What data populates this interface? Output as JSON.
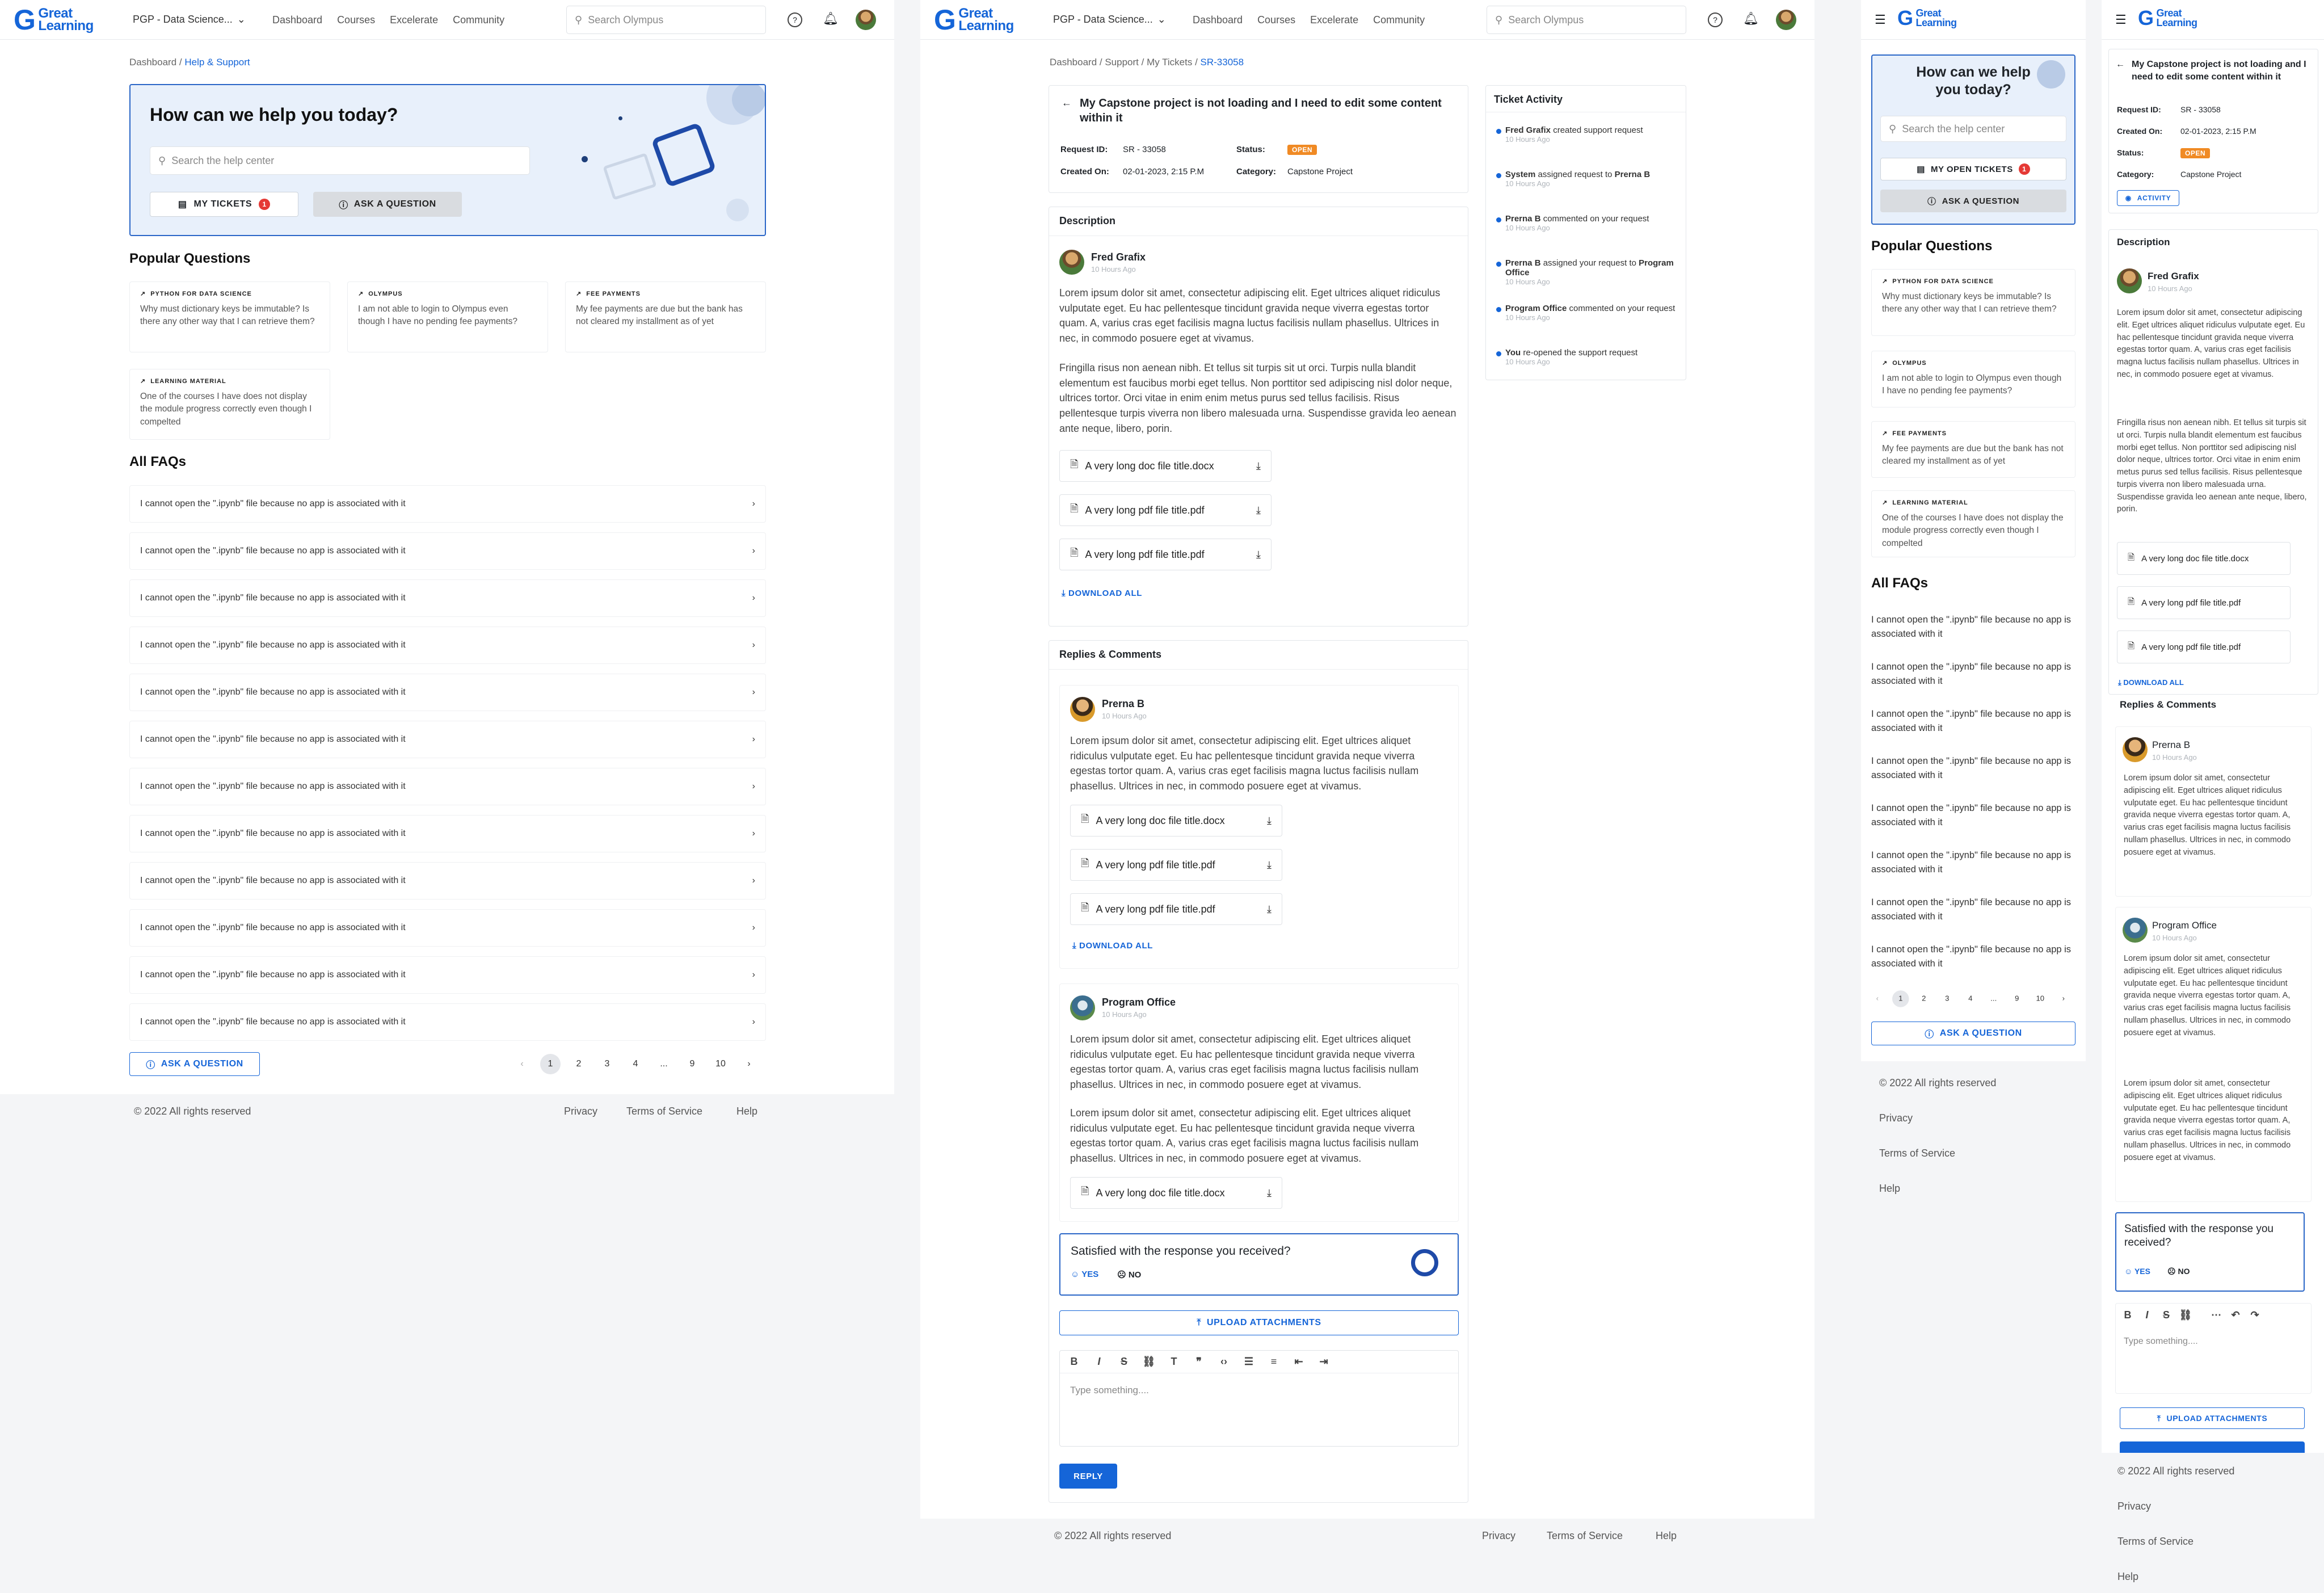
{
  "brand": {
    "line1": "Great",
    "line2": "Learning"
  },
  "header": {
    "program": "PGP - Data Science...",
    "nav": [
      "Dashboard",
      "Courses",
      "Excelerate",
      "Community"
    ],
    "search_placeholder": "Search Olympus"
  },
  "help": {
    "breadcrumb": [
      "Dashboard",
      "Help & Support"
    ],
    "hero_title": "How can we help you today?",
    "hero_title_mobile": "How can we help you today?",
    "search_placeholder": "Search the help center",
    "my_tickets": "MY TICKETS",
    "my_open_tickets": "MY OPEN TICKETS",
    "ticket_count": "1",
    "ask": "ASK A QUESTION",
    "popular_title": "Popular Questions",
    "popular": [
      {
        "tag": "PYTHON FOR DATA SCIENCE",
        "text": "Why must dictionary keys be immutable? Is there any other way that I can retrieve them?"
      },
      {
        "tag": "OLYMPUS",
        "text": "I am not able to login to Olympus even though I have no pending fee payments?"
      },
      {
        "tag": "FEE PAYMENTS",
        "text": "My fee payments are due but the bank has not cleared my installment as of yet"
      },
      {
        "tag": "LEARNING MATERIAL",
        "text": "One of the courses I have does not display the module progress correctly even though I compelted"
      },
      {
        "tag": "LEARNING MATERIAL",
        "text": "One of the courses I have does not display the module progress correctly even though I compelted"
      }
    ],
    "all_faqs_title": "All FAQs",
    "faq_item": "I cannot open the \".ipynb\" file because no app is associated with it",
    "pages": [
      "1",
      "2",
      "3",
      "4",
      "...",
      "9",
      "10"
    ]
  },
  "footer": {
    "copyright": "© 2022 All rights reserved",
    "links": [
      "Privacy",
      "Terms of Service",
      "Help"
    ]
  },
  "ticket": {
    "breadcrumb": [
      "Dashboard",
      "Support",
      "My Tickets",
      "SR-33058"
    ],
    "title": "My Capstone project is not loading and I need to edit some content within it",
    "request_id_label": "Request ID:",
    "request_id": "SR - 33058",
    "status_label": "Status:",
    "status": "OPEN",
    "created_label": "Created On:",
    "created": "02-01-2023, 2:15 P.M",
    "category_label": "Category:",
    "category": "Capstone Project",
    "activity_button": "ACTIVITY",
    "description_title": "Description",
    "author": "Fred Grafix",
    "time": "10 Hours Ago",
    "para1": "Lorem ipsum dolor sit amet, consectetur adipiscing elit. Eget ultrices aliquet ridiculus vulputate eget. Eu hac pellentesque tincidunt gravida neque viverra egestas tortor quam. A, varius cras eget facilisis magna luctus facilisis nullam phasellus. Ultrices in nec, in commodo posuere eget at vivamus.",
    "para2": "Fringilla risus non aenean nibh. Et tellus sit turpis sit ut orci. Turpis nulla blandit elementum est faucibus morbi eget tellus. Non porttitor sed adipiscing nisl dolor neque, ultrices tortor. Orci vitae in enim enim metus purus sed tellus facilisis. Risus pellentesque turpis viverra non libero malesuada urna. Suspendisse gravida leo aenean ante neque, libero, porin.",
    "files": [
      "A very long doc file title.docx",
      "A very long pdf file title.pdf",
      "A very long pdf file title.pdf"
    ],
    "download_all": "DOWNLOAD ALL",
    "replies_title": "Replies & Comments",
    "reply1_author": "Prerna B",
    "reply2_author": "Program Office",
    "reply_time": "10 Hours Ago",
    "satisfied": "Satisfied with the response you received?",
    "yes": "YES",
    "no": "NO",
    "upload": "UPLOAD ATTACHMENTS",
    "editor_placeholder": "Type something....",
    "editor_placeholder_mobile": "Type something....",
    "reply_button": "REPLY",
    "activity_title": "Ticket Activity",
    "activity": [
      {
        "who": "Fred Grafix",
        "text": " created support request"
      },
      {
        "who": "System",
        "text": " assigned request to ",
        "who2": "Prerna B"
      },
      {
        "who": "Prerna B",
        "text": " commented on your request"
      },
      {
        "who": "Prerna B",
        "text": " assigned your request to ",
        "who2": "Program Office"
      },
      {
        "who": "Program Office",
        "text": " commented on your request"
      },
      {
        "who": "You",
        "text": " re-opened the support request"
      }
    ],
    "activity_time": "10 Hours Ago"
  },
  "colors": {
    "primary": "#1565d8",
    "open": "#f08a24",
    "hero_bg": "#e8f0fb"
  }
}
